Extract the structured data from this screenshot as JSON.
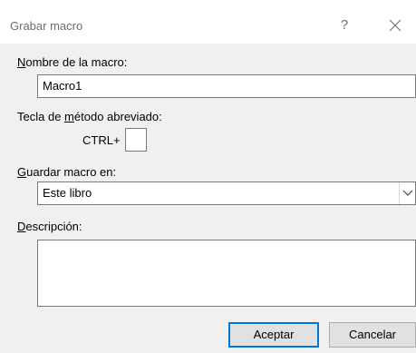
{
  "dialog": {
    "title": "Grabar macro",
    "help_label": "?",
    "close_icon": "close-icon"
  },
  "macro_name": {
    "label_first": "N",
    "label_rest": "ombre de la macro:",
    "value": "Macro1"
  },
  "shortcut": {
    "label_pre": "Tecla de ",
    "label_u": "m",
    "label_post": "étodo abreviado:",
    "prefix": "CTRL+",
    "value": ""
  },
  "store_in": {
    "label_first": "G",
    "label_rest": "uardar macro en:",
    "selected": "Este libro"
  },
  "description": {
    "label_first": "D",
    "label_rest": "escripción:",
    "value": ""
  },
  "buttons": {
    "ok": "Aceptar",
    "cancel": "Cancelar"
  }
}
